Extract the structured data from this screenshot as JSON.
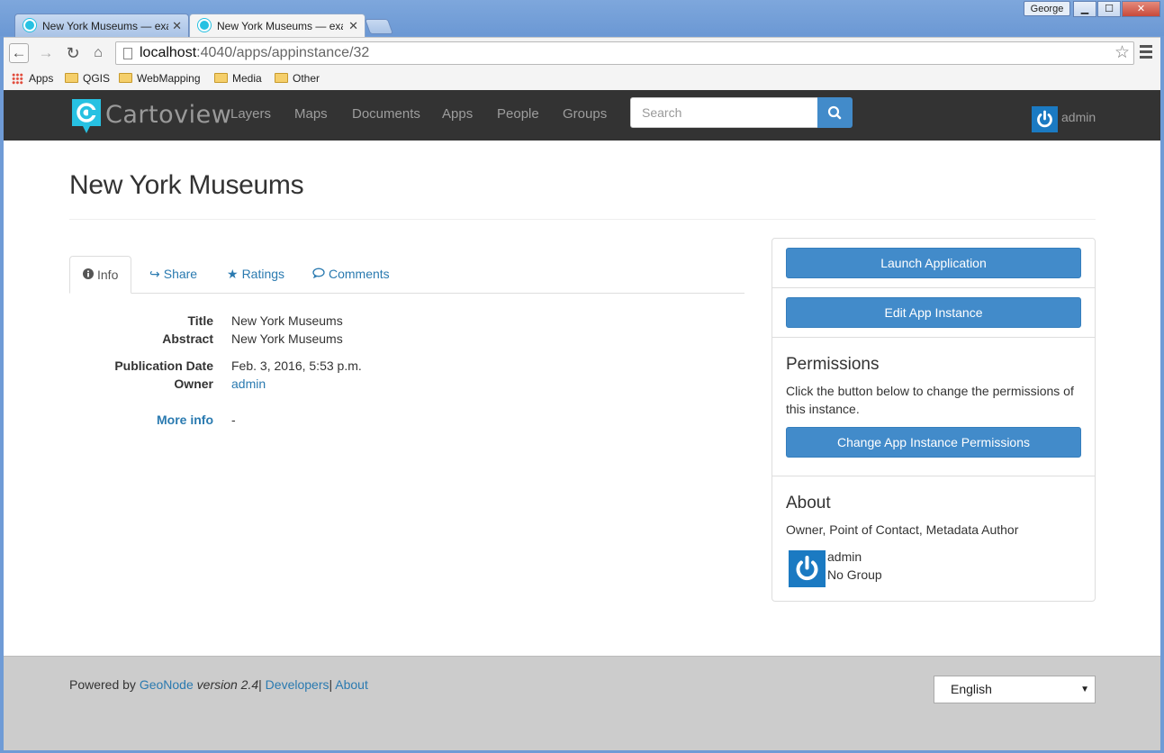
{
  "browser": {
    "tabs": [
      {
        "title": "New York Museums — exa",
        "active": false
      },
      {
        "title": "New York Museums — exa",
        "active": true
      }
    ],
    "user_chip": "George",
    "url_host": "localhost",
    "url_rest": ":4040/apps/appinstance/32",
    "bookmarks": [
      "Apps",
      "QGIS",
      "WebMapping",
      "Media",
      "Other"
    ]
  },
  "nav": {
    "brand": "Cartoview",
    "links": [
      "Layers",
      "Maps",
      "Documents",
      "Apps",
      "People",
      "Groups"
    ],
    "search_placeholder": "Search",
    "user": "admin"
  },
  "page": {
    "title": "New York Museums",
    "tabs": [
      {
        "label": "Info",
        "icon": "info-circle-icon"
      },
      {
        "label": "Share",
        "icon": "share-icon"
      },
      {
        "label": "Ratings",
        "icon": "star-icon"
      },
      {
        "label": "Comments",
        "icon": "comment-icon"
      }
    ],
    "info": {
      "title_label": "Title",
      "title_value": "New York Museums",
      "abstract_label": "Abstract",
      "abstract_value": "New York Museums",
      "pubdate_label": "Publication Date",
      "pubdate_value": "Feb. 3, 2016, 5:53 p.m.",
      "owner_label": "Owner",
      "owner_value": "admin",
      "moreinfo_label": "More info",
      "moreinfo_value": "-"
    }
  },
  "sidebar": {
    "launch": "Launch Application",
    "edit": "Edit App Instance",
    "permissions_title": "Permissions",
    "permissions_text": "Click the button below to change the permissions of this instance.",
    "permissions_button": "Change App Instance Permissions",
    "about_title": "About",
    "about_roles": "Owner, Point of Contact, Metadata Author",
    "about_user": "admin",
    "about_group": "No Group"
  },
  "footer": {
    "powered_by": "Powered by",
    "geonode": "GeoNode",
    "version": "version 2.4",
    "sep": "|",
    "developers": "Developers",
    "about": "About",
    "language": "English"
  },
  "colors": {
    "navbar": "#333333",
    "primary": "#428bca",
    "link": "#2a7ab0",
    "brand_accent": "#27c1e2",
    "footer": "#cccccc"
  }
}
